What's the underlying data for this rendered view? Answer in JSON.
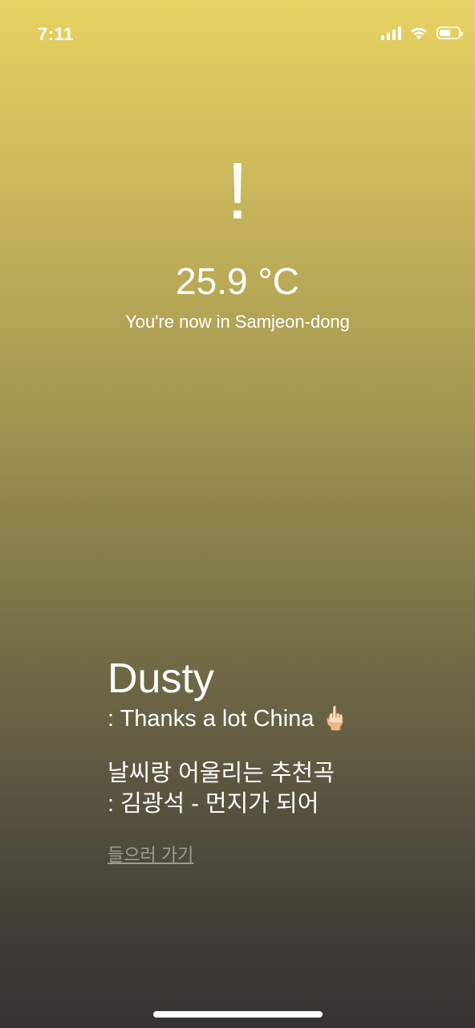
{
  "status_bar": {
    "time": "7:11",
    "signal_icon": "cellular-signal-icon",
    "wifi_icon": "wifi-icon",
    "battery_icon": "battery-icon",
    "battery_level": 0.6
  },
  "weather": {
    "icon_glyph": "!",
    "temperature": "25.9 °C",
    "location": "You're now in Samjeon-dong"
  },
  "info": {
    "condition": "Dusty",
    "condition_note": " : Thanks a lot China 🖕🏻",
    "recommendation_label": "날씨랑 어울리는 추천곡",
    "recommendation_song": " : 김광석 - 먼지가 되어",
    "listen_link": "들으러 가기"
  },
  "colors": {
    "gradient_top": "#e8d262",
    "gradient_bottom": "#353431",
    "text": "#ffffff"
  }
}
